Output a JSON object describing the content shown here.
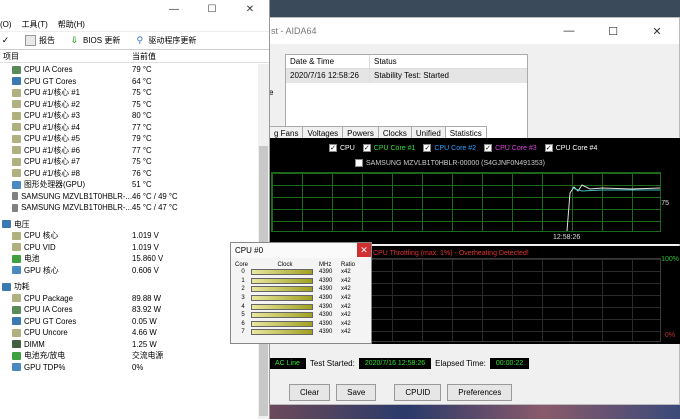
{
  "aida": {
    "title": "st - AIDA64",
    "status_headers": [
      "Date & Time",
      "Status"
    ],
    "status_row": {
      "date": "2020/7/16 12:58:26",
      "status": "Stability Test: Started"
    },
    "side_fragment": "e",
    "tabs": [
      "g Fans",
      "Voltages",
      "Powers",
      "Clocks",
      "Unified",
      "Statistics"
    ],
    "legend": [
      "CPU",
      "CPU Core #1",
      "CPU Core #2",
      "CPU Core #3",
      "CPU Core #4"
    ],
    "legend_colors": [
      "#ffffff",
      "#30e030",
      "#30a0ff",
      "#e040e0",
      "#ffffff"
    ],
    "samsung": "SAMSUNG MZVLB1T0HBLR-00000 (S4GJNF0N491353)",
    "graph_time": "12:58:26",
    "graph_value": "75",
    "throttle": "CPU Throttling (max: 1%) - Overheating Detected!",
    "graph2_top": "100%",
    "graph2_bottom": "0%",
    "battery_label": "AC Line",
    "test_started_label": "Test Started:",
    "test_started_value": "2020/7/16 12:58:26",
    "elapsed_label": "Elapsed Time:",
    "elapsed_value": "00:00:22",
    "buttons": {
      "clear": "Clear",
      "save": "Save",
      "cpuid": "CPUID",
      "preferences": "Preferences"
    }
  },
  "sensor": {
    "menu": [
      "(O)",
      "工具(T)",
      "帮助(H)"
    ],
    "toolbar": {
      "report": "报告",
      "bios": "BIOS 更新",
      "driver": "驱动程序更新"
    },
    "col_item": "项目",
    "col_value": "当前值",
    "temps": [
      {
        "name": "CPU IA Cores",
        "value": "79 °C",
        "color": "#5a8a5a"
      },
      {
        "name": "CPU GT Cores",
        "value": "64 °C",
        "color": "#3a7ab0"
      },
      {
        "name": "CPU #1/核心 #1",
        "value": "75 °C",
        "color": "#b0b080"
      },
      {
        "name": "CPU #1/核心 #2",
        "value": "75 °C",
        "color": "#b0b080"
      },
      {
        "name": "CPU #1/核心 #3",
        "value": "80 °C",
        "color": "#b0b080"
      },
      {
        "name": "CPU #1/核心 #4",
        "value": "77 °C",
        "color": "#b0b080"
      },
      {
        "name": "CPU #1/核心 #5",
        "value": "79 °C",
        "color": "#b0b080"
      },
      {
        "name": "CPU #1/核心 #6",
        "value": "77 °C",
        "color": "#b0b080"
      },
      {
        "name": "CPU #1/核心 #7",
        "value": "75 °C",
        "color": "#b0b080"
      },
      {
        "name": "CPU #1/核心 #8",
        "value": "76 °C",
        "color": "#b0b080"
      },
      {
        "name": "图形处理器(GPU)",
        "value": "51 °C",
        "color": "#4a8ac0"
      },
      {
        "name": "SAMSUNG MZVLB1T0HBLR-...",
        "value": "46 °C / 49 °C",
        "color": "#808080"
      },
      {
        "name": "SAMSUNG MZVLB1T0HBLR-...",
        "value": "45 °C / 47 °C",
        "color": "#808080"
      }
    ],
    "voltage_group": "电压",
    "voltages": [
      {
        "name": "CPU 核心",
        "value": "1.019 V",
        "color": "#b0b080"
      },
      {
        "name": "CPU VID",
        "value": "1.019 V",
        "color": "#b0b080"
      },
      {
        "name": "电池",
        "value": "15.860 V",
        "color": "#40a040"
      },
      {
        "name": "GPU 核心",
        "value": "0.606 V",
        "color": "#4a8ac0"
      }
    ],
    "power_group": "功耗",
    "powers": [
      {
        "name": "CPU Package",
        "value": "89.88 W",
        "color": "#b0b080"
      },
      {
        "name": "CPU IA Cores",
        "value": "83.92 W",
        "color": "#5a8a5a"
      },
      {
        "name": "CPU GT Cores",
        "value": "0.05 W",
        "color": "#3a7ab0"
      },
      {
        "name": "CPU Uncore",
        "value": "4.66 W",
        "color": "#b0b080"
      },
      {
        "name": "DIMM",
        "value": "1.25 W",
        "color": "#406040"
      },
      {
        "name": "电池充/放电",
        "value": "交流电源",
        "color": "#40a040"
      },
      {
        "name": "GPU TDP%",
        "value": "0%",
        "color": "#4a8ac0"
      }
    ]
  },
  "cpu0": {
    "title": "CPU #0",
    "headers": [
      "Core",
      "Clock",
      "MHz",
      "Ratio"
    ],
    "rows": [
      {
        "core": "0",
        "mhz": "4390",
        "ratio": "x42"
      },
      {
        "core": "1",
        "mhz": "4390",
        "ratio": "x42"
      },
      {
        "core": "2",
        "mhz": "4390",
        "ratio": "x42"
      },
      {
        "core": "3",
        "mhz": "4390",
        "ratio": "x42"
      },
      {
        "core": "4",
        "mhz": "4390",
        "ratio": "x42"
      },
      {
        "core": "5",
        "mhz": "4390",
        "ratio": "x42"
      },
      {
        "core": "6",
        "mhz": "4390",
        "ratio": "x42"
      },
      {
        "core": "7",
        "mhz": "4390",
        "ratio": "x42"
      }
    ]
  }
}
